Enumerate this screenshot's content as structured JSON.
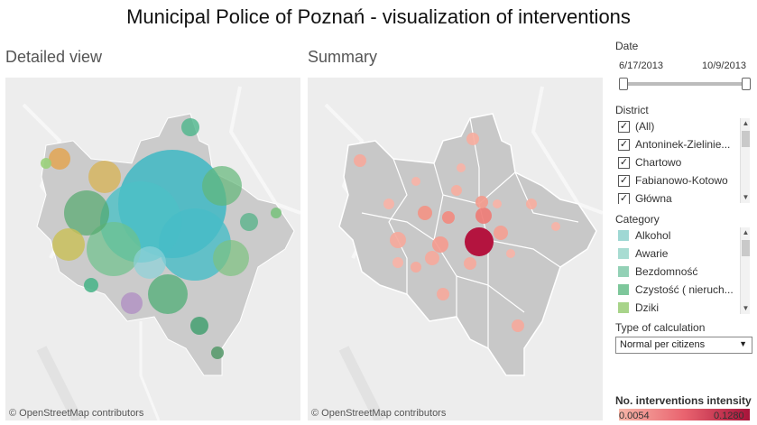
{
  "title": "Municipal Police of Poznań - visualization of interventions",
  "sections": {
    "detailed": "Detailed view",
    "summary": "Summary"
  },
  "attribution": "© OpenStreetMap contributors",
  "filters": {
    "date": {
      "label": "Date",
      "start": "6/17/2013",
      "end": "10/9/2013"
    },
    "district": {
      "label": "District",
      "items": [
        {
          "label": "(All)",
          "checked": true
        },
        {
          "label": "Antoninek-Zielinie...",
          "checked": true
        },
        {
          "label": "Chartowo",
          "checked": true
        },
        {
          "label": "Fabianowo-Kotowo",
          "checked": true
        },
        {
          "label": "Główna",
          "checked": true
        }
      ]
    },
    "category": {
      "label": "Category",
      "items": [
        {
          "label": "Alkohol",
          "color": "#9fd8d4"
        },
        {
          "label": "Awarie",
          "color": "#a8dcd2"
        },
        {
          "label": "Bezdomność",
          "color": "#93d1b6"
        },
        {
          "label": "Czystość ( nieruch...",
          "color": "#7ec79b"
        },
        {
          "label": "Dziki",
          "color": "#a8d48a"
        }
      ]
    },
    "calculation": {
      "label": "Type of calculation",
      "value": "Normal per citizens"
    }
  },
  "legend": {
    "label": "No. interventions intensity",
    "min": "0.0054",
    "max": "0.1280",
    "colors": {
      "low": "#f7b6a8",
      "mid": "#e9636f",
      "high": "#a8133a"
    }
  },
  "icons": {
    "checkbox": "checkmark-icon",
    "scroll_up": "scroll-up-arrow-icon",
    "scroll_down": "scroll-down-arrow-icon",
    "dropdown": "chevron-down-icon"
  }
}
